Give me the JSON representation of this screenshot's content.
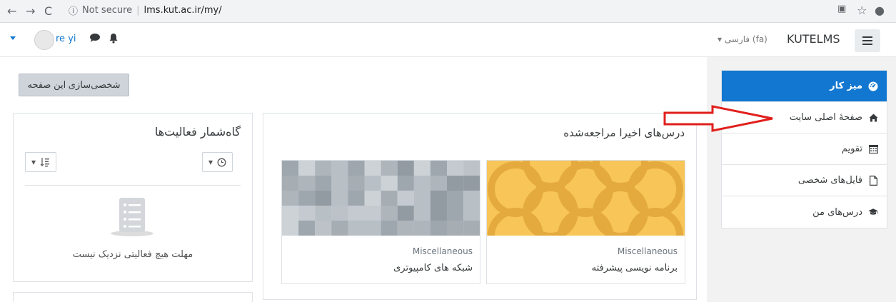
{
  "browser": {
    "security_label": "Not secure",
    "url": "lms.kut.ac.ir/my/"
  },
  "navbar": {
    "username": "re yi",
    "language": "فارسی (fa)",
    "brand": "KUTELMS"
  },
  "main": {
    "customize_button": "شخصی‌سازی این صفحه",
    "timeline": {
      "title": "گاه‌شمار فعالیت‌ها",
      "empty_text": "مهلت هیچ فعالیتی نزدیک نیست"
    },
    "recent_courses": {
      "title": "درس‌های اخیرا مراجعه‌شده",
      "courses": [
        {
          "category": "Miscellaneous",
          "name": "برنامه نویسی پیشرفته"
        },
        {
          "category": "Miscellaneous",
          "name": "شبکه های کامپیوتری"
        }
      ]
    }
  },
  "drawer": {
    "items": [
      {
        "label": "میز کار",
        "icon": "dashboard-icon"
      },
      {
        "label": "صفحهٔ اصلی سایت",
        "icon": "home-icon"
      },
      {
        "label": "تقویم",
        "icon": "calendar-icon"
      },
      {
        "label": "فایل‌های شخصی",
        "icon": "file-icon"
      },
      {
        "label": "درس‌های من",
        "icon": "graduation-cap-icon"
      }
    ]
  },
  "colors": {
    "accent": "#1177d1",
    "annotation": "#e0201c"
  }
}
